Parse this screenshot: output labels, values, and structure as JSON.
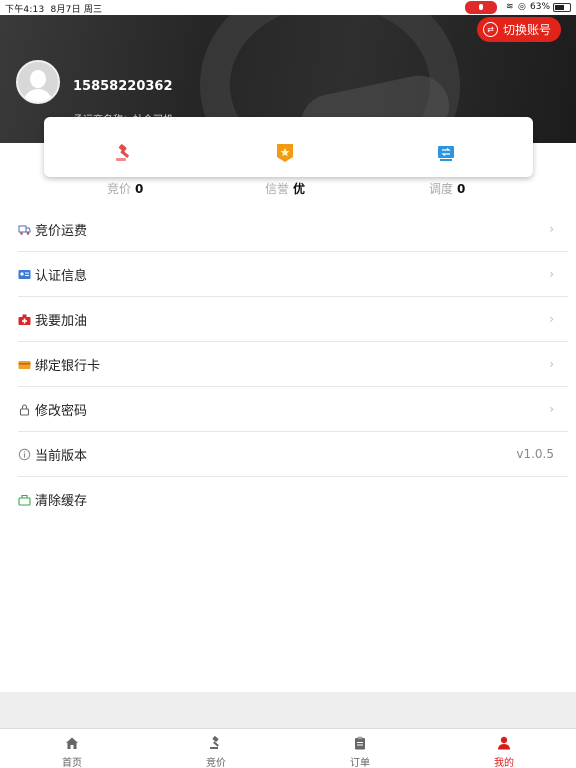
{
  "status_bar": {
    "time": "下午4:13",
    "date": "8月7日 周三",
    "battery_text": "63%",
    "battery_level": 0.63
  },
  "header": {
    "switch_account_label": "切换账号",
    "phone": "15858220362",
    "carrier": "承运商名称：社会司机"
  },
  "stats": [
    {
      "label": "竞价",
      "value": "0",
      "icon": "gavel-icon"
    },
    {
      "label": "信誉",
      "value": "优",
      "icon": "reputation-badge-icon"
    },
    {
      "label": "调度",
      "value": "0",
      "icon": "dispatch-icon"
    }
  ],
  "menu": [
    {
      "label": "竞价运费",
      "icon": "truck-icon",
      "arrow": "›"
    },
    {
      "label": "认证信息",
      "icon": "id-card-icon",
      "arrow": "›"
    },
    {
      "label": "我要加油",
      "icon": "fuel-icon",
      "arrow": "›"
    },
    {
      "label": "绑定银行卡",
      "icon": "bank-card-icon",
      "arrow": "›"
    },
    {
      "label": "修改密码",
      "icon": "lock-icon",
      "arrow": "›"
    },
    {
      "label": "当前版本",
      "icon": "info-icon",
      "value": "v1.0.5"
    },
    {
      "label": "清除缓存",
      "icon": "clear-cache-icon"
    }
  ],
  "tabs": [
    {
      "label": "首页",
      "icon": "home-icon",
      "active": false
    },
    {
      "label": "竞价",
      "icon": "gavel-icon",
      "active": false
    },
    {
      "label": "订单",
      "icon": "clipboard-icon",
      "active": false
    },
    {
      "label": "我的",
      "icon": "user-icon",
      "active": true
    }
  ],
  "colors": {
    "accent": "#e2231a",
    "active_tab": "#d91e18"
  }
}
